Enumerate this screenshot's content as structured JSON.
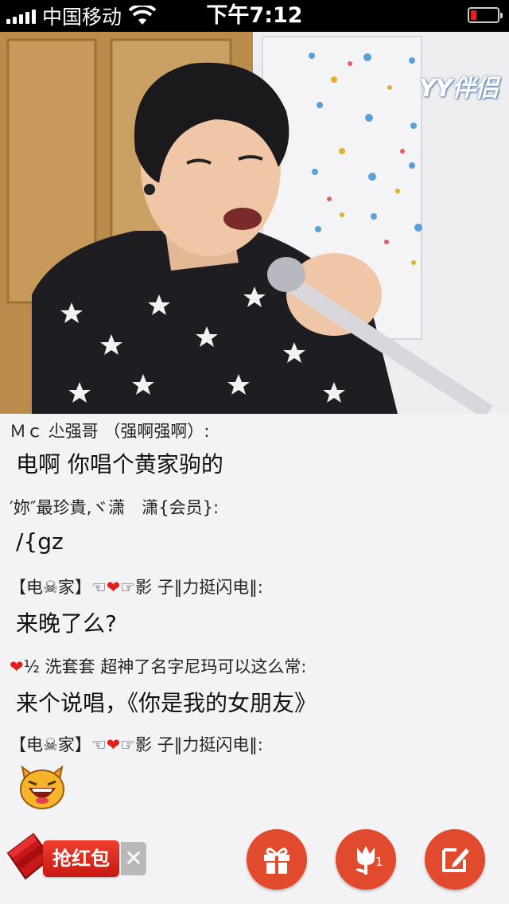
{
  "status_bar": {
    "carrier": "中国移动",
    "time": "下午7:12"
  },
  "video": {
    "watermark": "YY伴侣"
  },
  "chat": {
    "messages": [
      {
        "user": "Ｍｃ 尐强哥 （强啊强啊）:",
        "text": "电啊  你唱个黄家驹的"
      },
      {
        "user": "′妳″最珍貴,ヾ潇　潇{会员}:",
        "text": "/{gz"
      },
      {
        "user_prefix": "【电☠家】☜",
        "user_suffix": "☞影 子‖力挺闪电‖:",
        "text": "来晚了么?"
      },
      {
        "user_suffix": "½  洗套套 超神了名字尼玛可以这么常:",
        "text": "来个说唱，《你是我的女朋友》"
      },
      {
        "user_prefix": "【电☠家】☜",
        "user_suffix": "☞影 子‖力挺闪电‖:",
        "emoji": "cat-laugh-icon"
      }
    ]
  },
  "bottom_bar": {
    "red_packet_label": "抢红包",
    "close_glyph": "✕",
    "flower_count": "1"
  },
  "colors": {
    "accent": "#e14a2c",
    "background": "#f3f3f5"
  }
}
